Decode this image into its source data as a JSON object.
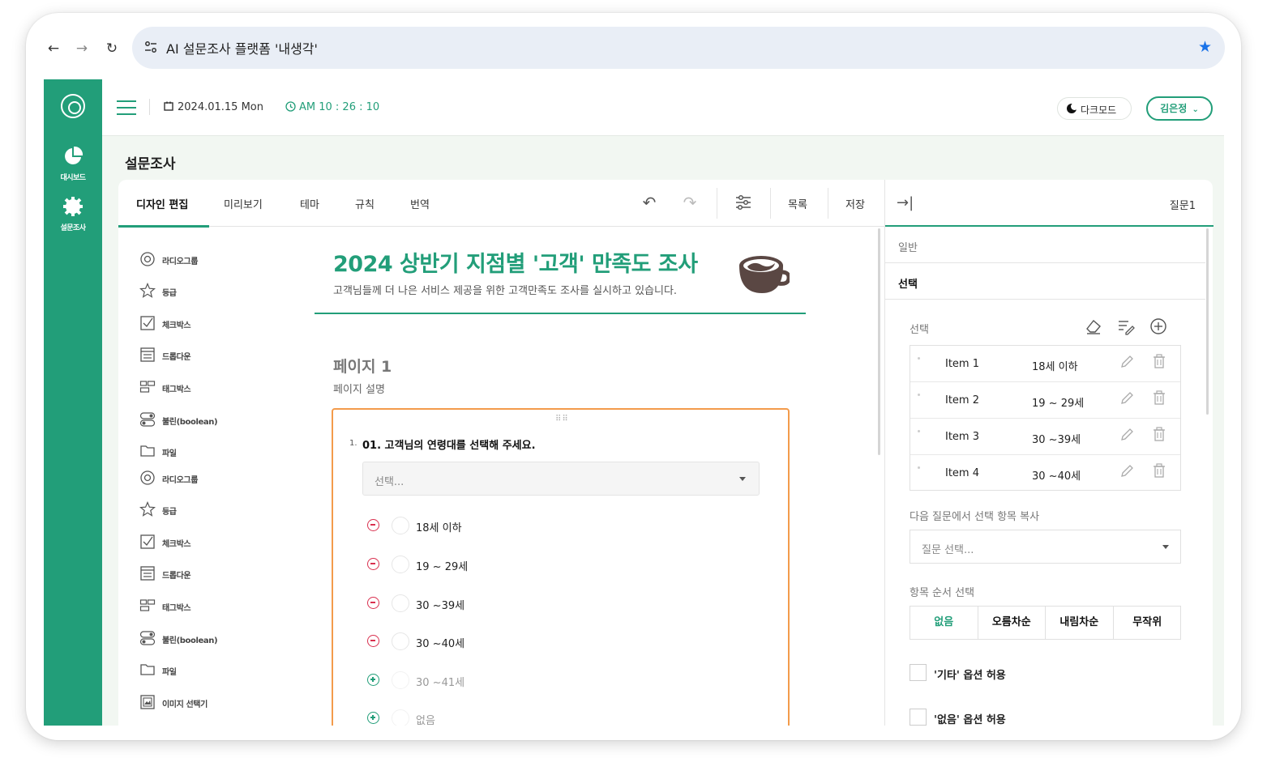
{
  "browser": {
    "tab_title": "AI 설문조사 플랫폼 '내생각'"
  },
  "rail": {
    "items": [
      {
        "label": "대시보드",
        "icon": "pie-chart-icon"
      },
      {
        "label": "설문조사",
        "icon": "gear-icon"
      }
    ]
  },
  "topbar": {
    "date": "2024.01.15 Mon",
    "time": "AM 10 : 26 : 10",
    "darkmode_label": "다크모드",
    "user_name": "김은정"
  },
  "page": {
    "title": "설문조사"
  },
  "editor": {
    "tabs": [
      "디자인 편집",
      "미리보기",
      "테마",
      "규칙",
      "번역"
    ],
    "list_label": "목록",
    "save_label": "저장"
  },
  "palette": {
    "items": [
      {
        "label": "라디오그룹",
        "icon": "radio-group-icon"
      },
      {
        "label": "등급",
        "icon": "star-icon"
      },
      {
        "label": "체크박스",
        "icon": "checkbox-icon"
      },
      {
        "label": "드롭다운",
        "icon": "dropdown-icon"
      },
      {
        "label": "태그박스",
        "icon": "tagbox-icon"
      },
      {
        "label": "불린(boolean)",
        "icon": "toggle-icon"
      },
      {
        "label": "파일",
        "icon": "folder-icon"
      },
      {
        "label": "라디오그룹",
        "icon": "radio-group-icon"
      },
      {
        "label": "등급",
        "icon": "star-icon"
      },
      {
        "label": "체크박스",
        "icon": "checkbox-icon"
      },
      {
        "label": "드롭다운",
        "icon": "dropdown-icon"
      },
      {
        "label": "태그박스",
        "icon": "tagbox-icon"
      },
      {
        "label": "불린(boolean)",
        "icon": "toggle-icon"
      },
      {
        "label": "파일",
        "icon": "folder-icon"
      },
      {
        "label": "이미지 선택기",
        "icon": "image-picker-icon"
      }
    ]
  },
  "survey": {
    "title": "2024 상반기 지점별 '고객' 만족도 조사",
    "description": "고객님들께 더 나은 서비스 제공을 위한 고객만족도 조사를 실시하고 있습니다.",
    "page_name": "페이지 1",
    "page_description": "페이지 설명",
    "question": {
      "number": "1.",
      "text": "01. 고객님의 연령대를 선택해 주세요.",
      "select_placeholder": "선택...",
      "choices": [
        {
          "label": "18세 이하",
          "state": "removable"
        },
        {
          "label": "19 ~ 29세",
          "state": "removable"
        },
        {
          "label": "30 ~39세",
          "state": "removable"
        },
        {
          "label": "30 ~40세",
          "state": "removable"
        },
        {
          "label": "30 ~41세",
          "state": "addable"
        },
        {
          "label": "없음",
          "state": "addable"
        }
      ]
    }
  },
  "props": {
    "question_label": "질문1",
    "sections": {
      "general": "일반",
      "choices": "선택"
    },
    "choices_label": "선택",
    "items": [
      {
        "name": "Item 1",
        "value": "18세 이하"
      },
      {
        "name": "Item 2",
        "value": "19 ~ 29세"
      },
      {
        "name": "Item 3",
        "value": "30 ~39세"
      },
      {
        "name": "Item 4",
        "value": "30 ~40세"
      }
    ],
    "copy_label": "다음 질문에서 선택 항목 복사",
    "copy_placeholder": "질문 선택...",
    "order_label": "항목 순서 선택",
    "order_options": [
      "없음",
      "오름차순",
      "내림차순",
      "무작위"
    ],
    "order_selected": "없음",
    "allow_other": "'기타' 옵션 허용",
    "allow_none": "'없음' 옵션 허용"
  },
  "colors": {
    "brand": "#229e79",
    "question_border": "#f39b4b",
    "remove": "#d9304f"
  }
}
